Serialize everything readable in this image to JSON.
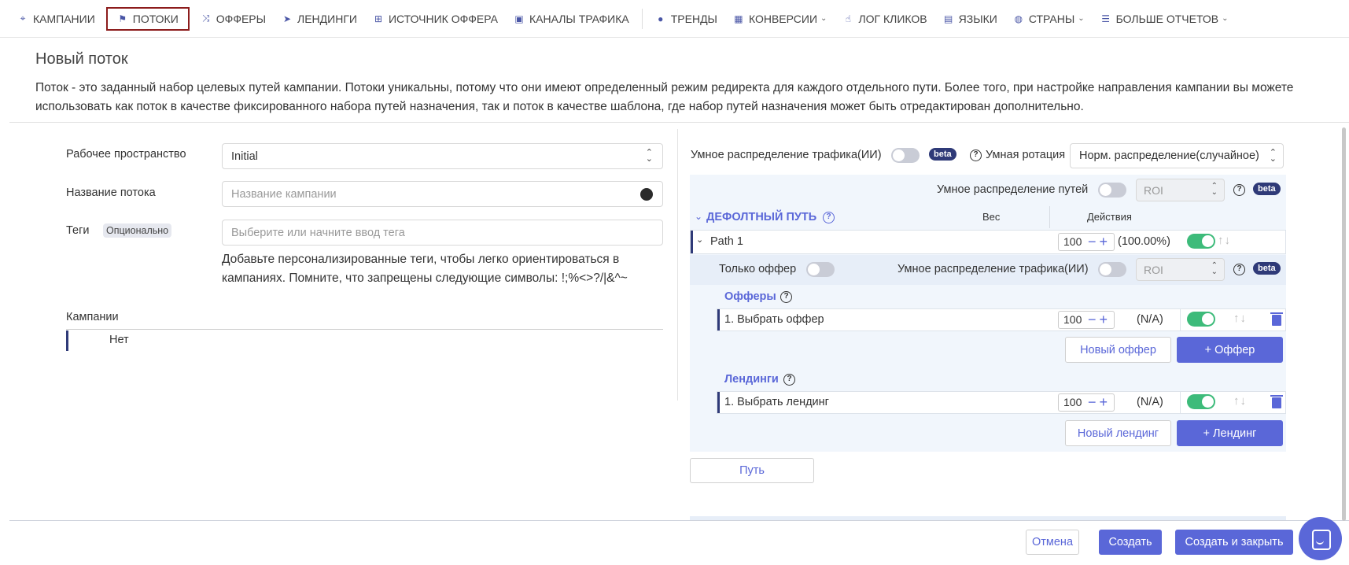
{
  "nav": {
    "campaigns": "КАМПАНИИ",
    "flows": "ПОТОКИ",
    "offers": "ОФФЕРЫ",
    "landings": "ЛЕНДИНГИ",
    "offer_source": "ИСТОЧНИК ОФФЕРА",
    "traffic_channels": "КАНАЛЫ ТРАФИКА",
    "trends": "ТРЕНДЫ",
    "conversions": "КОНВЕРСИИ",
    "click_log": "ЛОГ КЛИКОВ",
    "languages": "ЯЗЫКИ",
    "countries": "СТРАНЫ",
    "more_reports": "БОЛЬШЕ ОТЧЕТОВ"
  },
  "page": {
    "title": "Новый поток",
    "description": "Поток - это заданный набор целевых путей кампании. Потоки уникальны, потому что они имеют определенный режим редиректа для каждого отдельного пути. Более того, при настройке направления кампании вы можете использовать как поток в качестве фиксированного набора путей назначения, так и поток в качестве шаблона, где набор путей назначения может быть отредактирован дополнительно."
  },
  "form": {
    "workspace_label": "Рабочее пространство",
    "workspace_value": "Initial",
    "flow_name_label": "Название потока",
    "flow_name_placeholder": "Название кампании",
    "tags_label": "Теги",
    "tags_optional": "Опционально",
    "tags_placeholder": "Выберите или начните ввод тега",
    "tags_hint": "Добавьте персонализированные теги, чтобы легко ориентироваться в кампаниях. Помните, что запрещены следующие символы: !;%<>?/|&^~",
    "campaigns_label": "Кампании",
    "campaigns_value": "Нет"
  },
  "panel": {
    "smart_traffic_label": "Умное распределение трафика(ИИ)",
    "beta": "beta",
    "smart_rotation_label": "Умная ротация",
    "rotation_value": "Норм. распределение(случайное)",
    "smart_paths_label": "Умное распределение путей",
    "roi": "ROI",
    "default_path": "ДЕФОЛТНЫЙ ПУТЬ",
    "weight_col": "Вес",
    "actions_col": "Действия",
    "path_name": "Path 1",
    "path_weight": "100",
    "path_percent": "(100.00%)",
    "only_offer_label": "Только оффер",
    "offers_section": "Офферы",
    "offer_item": "1. Выбрать оффер",
    "offer_weight": "100",
    "offer_percent": "(N/A)",
    "new_offer_btn": "Новый оффер",
    "add_offer_btn": "+ Оффер",
    "landings_section": "Лендинги",
    "landing_item": "1. Выбрать лендинг",
    "landing_weight": "100",
    "landing_percent": "(N/A)",
    "new_landing_btn": "Новый лендинг",
    "add_landing_btn": "+ Лендинг",
    "path_btn": "Путь"
  },
  "footer": {
    "cancel": "Отмена",
    "create": "Создать",
    "create_close": "Создать и закрыть"
  },
  "colors": {
    "accent": "#5a67d8",
    "dark_accent": "#2f3a78",
    "toggle_on": "#3dbb7a",
    "active_border": "#8c1c1c"
  }
}
